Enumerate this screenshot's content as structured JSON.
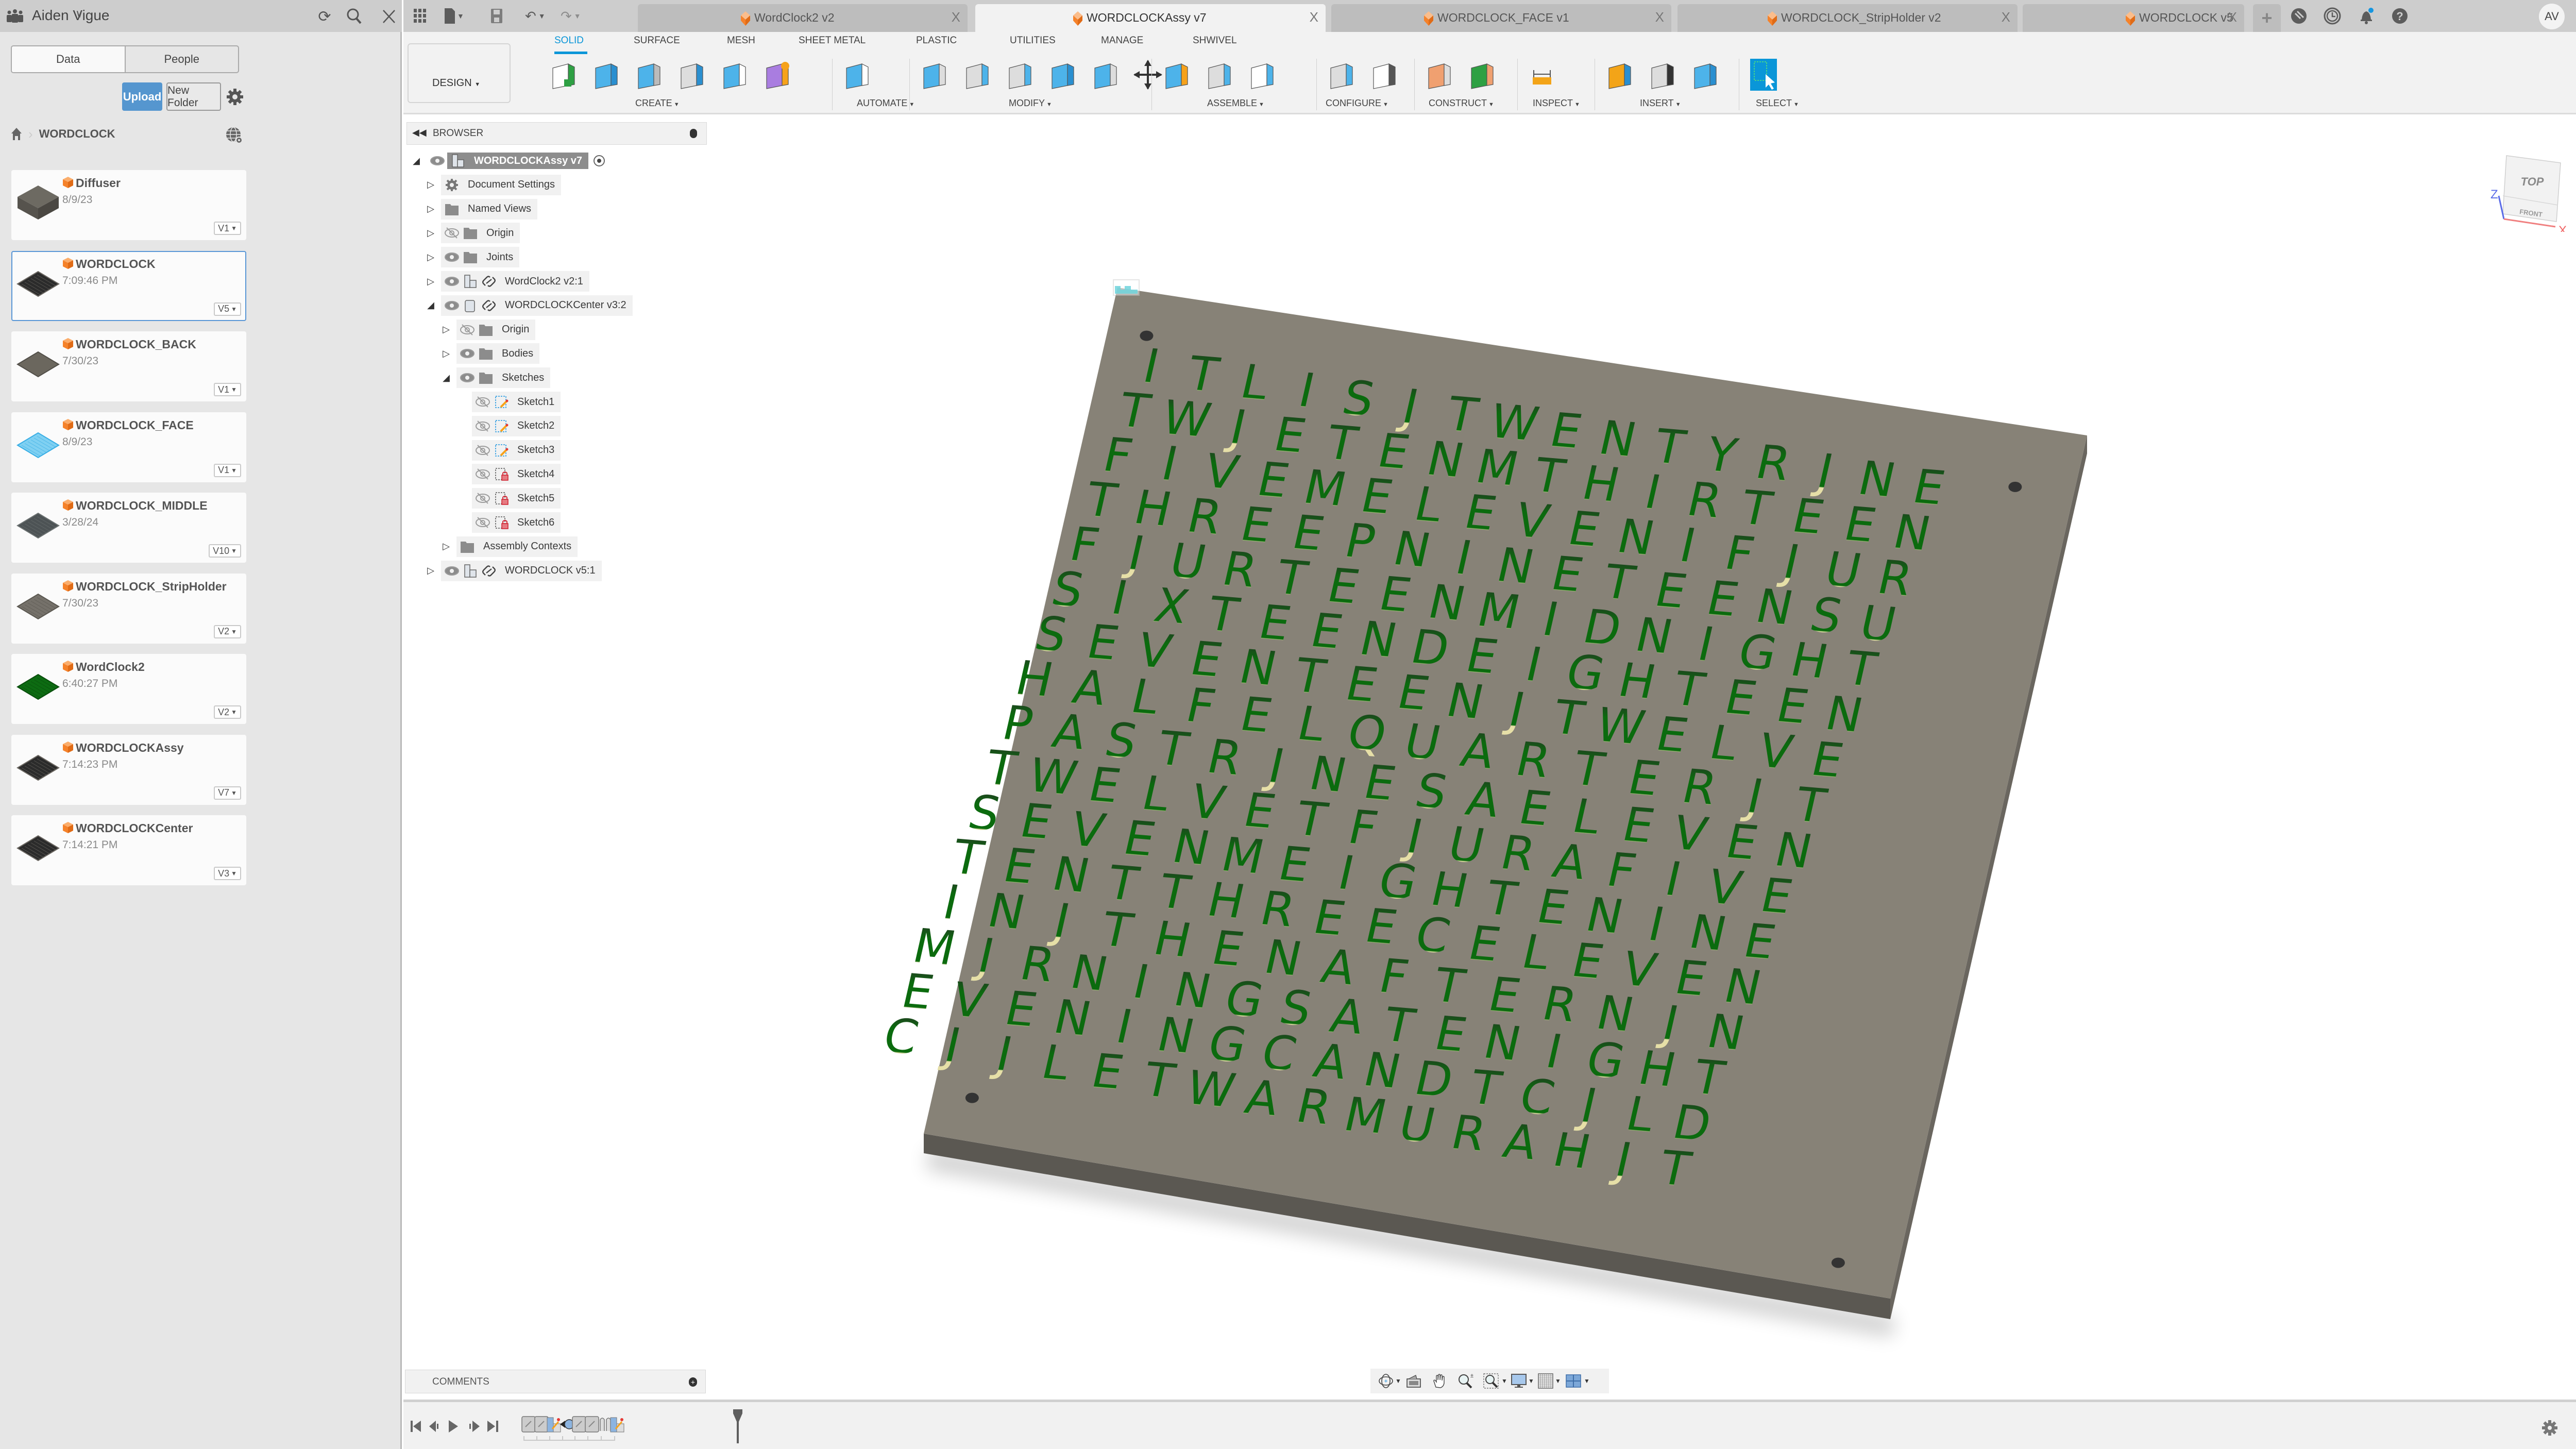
{
  "left_panel": {
    "team_name": "Aiden Vigue",
    "tabs": [
      "Data",
      "People"
    ],
    "active_tab": "Data",
    "upload_label": "Upload",
    "new_folder_label": "New Folder",
    "breadcrumb": {
      "home_icon": "home-icon",
      "current": "WORDCLOCK"
    },
    "files": [
      {
        "name": "Diffuser",
        "date": "8/9/23",
        "version": "V1",
        "thumb": "gray-box",
        "selected": false
      },
      {
        "name": "WORDCLOCK",
        "date": "7:09:46 PM",
        "version": "V5",
        "thumb": "dark-grid",
        "selected": true
      },
      {
        "name": "WORDCLOCK_BACK",
        "date": "7/30/23",
        "version": "V1",
        "thumb": "gray-plate",
        "selected": false
      },
      {
        "name": "WORDCLOCK_FACE",
        "date": "8/9/23",
        "version": "V1",
        "thumb": "blue-sketch",
        "selected": false
      },
      {
        "name": "WORDCLOCK_MIDDLE",
        "date": "3/28/24",
        "version": "V10",
        "thumb": "slate-grid",
        "selected": false
      },
      {
        "name": "WORDCLOCK_StripHolder",
        "date": "7/30/23",
        "version": "V2",
        "thumb": "gray-frame",
        "selected": false
      },
      {
        "name": "WordClock2",
        "date": "6:40:27 PM",
        "version": "V2",
        "thumb": "green-pcb",
        "selected": false
      },
      {
        "name": "WORDCLOCKAssy",
        "date": "7:14:23 PM",
        "version": "V7",
        "thumb": "dark-grid",
        "selected": false
      },
      {
        "name": "WORDCLOCKCenter",
        "date": "7:14:21 PM",
        "version": "V3",
        "thumb": "dark-grid",
        "selected": false
      }
    ]
  },
  "tabbar": {
    "tabs": [
      {
        "label": "WordClock2 v2",
        "active": false
      },
      {
        "label": "WORDCLOCKAssy v7",
        "active": true
      },
      {
        "label": "WORDCLOCK_FACE v1",
        "active": false
      },
      {
        "label": "WORDCLOCK_StripHolder v2",
        "active": false
      },
      {
        "label": "WORDCLOCK v5",
        "active": false
      }
    ],
    "close_glyph": "X",
    "avatar_initials": "AV"
  },
  "toolbar": {
    "workspace": "DESIGN",
    "workspace_tabs": [
      "SOLID",
      "SURFACE",
      "MESH",
      "SHEET METAL",
      "PLASTIC",
      "UTILITIES",
      "MANAGE",
      "SHWIVEL"
    ],
    "active_workspace_tab": "SOLID",
    "groups": [
      {
        "label": "CREATE",
        "tools": [
          "create-sketch",
          "revolve",
          "extrude",
          "hole",
          "pattern",
          "form"
        ]
      },
      {
        "label": "AUTOMATE",
        "tools": [
          "automate"
        ]
      },
      {
        "label": "MODIFY",
        "tools": [
          "press-pull",
          "fillet",
          "shell",
          "combine",
          "offset-face",
          "move"
        ]
      },
      {
        "label": "ASSEMBLE",
        "tools": [
          "new-component",
          "joint",
          "bom"
        ]
      },
      {
        "label": "CONFIGURE",
        "tools": [
          "configure",
          "configure-table"
        ]
      },
      {
        "label": "CONSTRUCT",
        "tools": [
          "offset-plane",
          "midplane"
        ]
      },
      {
        "label": "INSPECT",
        "tools": [
          "measure"
        ]
      },
      {
        "label": "INSERT",
        "tools": [
          "insert-svg",
          "insert-mesh",
          "canvas"
        ]
      },
      {
        "label": "SELECT",
        "tools": [
          "select"
        ]
      }
    ]
  },
  "browser": {
    "title": "BROWSER",
    "tree": [
      {
        "label": "WORDCLOCKAssy v7",
        "level": 0,
        "expanded": true,
        "visible": true,
        "icon": "assembly",
        "root": true
      },
      {
        "label": "Document Settings",
        "level": 1,
        "expanded": false,
        "icon": "gear"
      },
      {
        "label": "Named Views",
        "level": 1,
        "expanded": false,
        "icon": "folder"
      },
      {
        "label": "Origin",
        "level": 1,
        "expanded": false,
        "visible": false,
        "icon": "folder"
      },
      {
        "label": "Joints",
        "level": 1,
        "expanded": false,
        "visible": true,
        "icon": "folder"
      },
      {
        "label": "WordClock2 v2:1",
        "level": 1,
        "expanded": false,
        "visible": true,
        "icon": "assembly",
        "linked": true
      },
      {
        "label": "WORDCLOCKCenter v3:2",
        "level": 1,
        "expanded": true,
        "visible": true,
        "icon": "component",
        "linked": true
      },
      {
        "label": "Origin",
        "level": 2,
        "expanded": false,
        "visible": false,
        "icon": "folder"
      },
      {
        "label": "Bodies",
        "level": 2,
        "expanded": false,
        "visible": true,
        "icon": "folder"
      },
      {
        "label": "Sketches",
        "level": 2,
        "expanded": true,
        "visible": true,
        "icon": "folder"
      },
      {
        "label": "Sketch1",
        "level": 3,
        "visible": false,
        "icon": "sketch"
      },
      {
        "label": "Sketch2",
        "level": 3,
        "visible": false,
        "icon": "sketch"
      },
      {
        "label": "Sketch3",
        "level": 3,
        "visible": false,
        "icon": "sketch"
      },
      {
        "label": "Sketch4",
        "level": 3,
        "visible": false,
        "icon": "sketch-locked"
      },
      {
        "label": "Sketch5",
        "level": 3,
        "visible": false,
        "icon": "sketch-locked"
      },
      {
        "label": "Sketch6",
        "level": 3,
        "visible": false,
        "icon": "sketch-locked"
      },
      {
        "label": "Assembly Contexts",
        "level": 2,
        "expanded": false,
        "icon": "folder"
      },
      {
        "label": "WORDCLOCK v5:1",
        "level": 1,
        "expanded": false,
        "visible": true,
        "icon": "assembly",
        "linked": true
      }
    ]
  },
  "viewport": {
    "viewcube": {
      "top": "TOP",
      "front": "FRONT",
      "axis_x": "X",
      "axis_z": "Z"
    },
    "word_grid": [
      "ITLISʃTWENTYRʃNE",
      "TWʃETENMTHIRTEEN",
      "FIVEMELEVENIFʃUR",
      "THREEPNINETEENSU",
      "FʃURTEENMIDNIGHT",
      "SIXTEENDEIGHTEEN",
      "SEVENTEENʃTWELVE",
      "HALFELQUARTERʃT",
      "PASTRʃNESAELEVEN",
      "TWELVETFʃURAFIVE",
      "SEVENMEIGHTENINE",
      "TENTTHREECELEVEN",
      "INʃTHENAFTERNʃN",
      "MʃRNINGSATENIGHT",
      "EVENINGCANDTCʃLD",
      "CʃʃLETWARMURAHʃT"
    ],
    "colors": {
      "plate": "#878277",
      "plate_side": "#5b5852",
      "letter_green": "#0b6b0e",
      "letter_dark": "#2d2d2d",
      "letter_cream": "#e6dfa7"
    }
  },
  "comments": {
    "title": "COMMENTS"
  },
  "colors": {
    "accent": "#0a96d8",
    "upload": "#5596cf",
    "selection": "#5a97d6",
    "file_icon": "#f5822a"
  }
}
